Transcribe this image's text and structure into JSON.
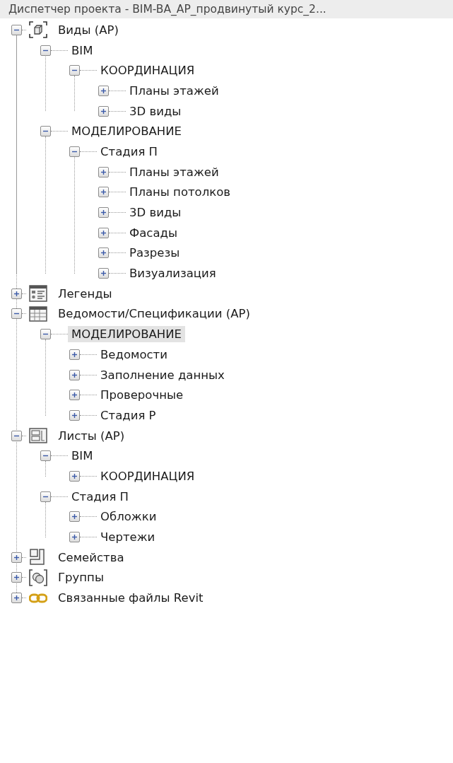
{
  "window": {
    "title": "Диспетчер проекта - BIM-BA_AP_продвинутый курс_2..."
  },
  "tree": [
    {
      "kind": "views",
      "label": "Виды (AP)",
      "expanded": true,
      "selected": false,
      "children": [
        {
          "label": "BIM",
          "expanded": true,
          "selected": false,
          "children": [
            {
              "label": "КООРДИНАЦИЯ",
              "expanded": true,
              "selected": false,
              "children": [
                {
                  "label": "Планы этажей",
                  "expanded": false,
                  "selected": false
                },
                {
                  "label": "3D виды",
                  "expanded": false,
                  "selected": false
                }
              ]
            }
          ]
        },
        {
          "label": "МОДЕЛИРОВАНИЕ",
          "expanded": true,
          "selected": false,
          "children": [
            {
              "label": "Стадия П",
              "expanded": true,
              "selected": false,
              "children": [
                {
                  "label": "Планы этажей",
                  "expanded": false,
                  "selected": false
                },
                {
                  "label": "Планы потолков",
                  "expanded": false,
                  "selected": false
                },
                {
                  "label": "3D виды",
                  "expanded": false,
                  "selected": false
                },
                {
                  "label": "Фасады",
                  "expanded": false,
                  "selected": false
                },
                {
                  "label": "Разрезы",
                  "expanded": false,
                  "selected": false
                },
                {
                  "label": "Визуализация",
                  "expanded": false,
                  "selected": false
                }
              ]
            }
          ]
        }
      ]
    },
    {
      "kind": "legends",
      "label": "Легенды",
      "expanded": false,
      "selected": false
    },
    {
      "kind": "schedules",
      "label": "Ведомости/Спецификации (AP)",
      "expanded": true,
      "selected": false,
      "children": [
        {
          "label": "МОДЕЛИРОВАНИЕ",
          "expanded": true,
          "selected": true,
          "children": [
            {
              "label": "Ведомости",
              "expanded": false,
              "selected": false
            },
            {
              "label": "Заполнение данных",
              "expanded": false,
              "selected": false
            },
            {
              "label": "Проверочные",
              "expanded": false,
              "selected": false
            },
            {
              "label": "Стадия Р",
              "expanded": false,
              "selected": false
            }
          ]
        }
      ]
    },
    {
      "kind": "sheets",
      "label": "Листы (AP)",
      "expanded": true,
      "selected": false,
      "children": [
        {
          "label": "BIM",
          "expanded": true,
          "selected": false,
          "children": [
            {
              "label": "КООРДИНАЦИЯ",
              "expanded": false,
              "selected": false
            }
          ]
        },
        {
          "label": "Стадия П",
          "expanded": true,
          "selected": false,
          "children": [
            {
              "label": "Обложки",
              "expanded": false,
              "selected": false
            },
            {
              "label": "Чертежи",
              "expanded": false,
              "selected": false
            }
          ]
        }
      ]
    },
    {
      "kind": "families",
      "label": "Семейства",
      "expanded": false,
      "selected": false
    },
    {
      "kind": "groups",
      "label": "Группы",
      "expanded": false,
      "selected": false
    },
    {
      "kind": "links",
      "label": "Связанные файлы Revit",
      "expanded": false,
      "selected": false
    }
  ]
}
